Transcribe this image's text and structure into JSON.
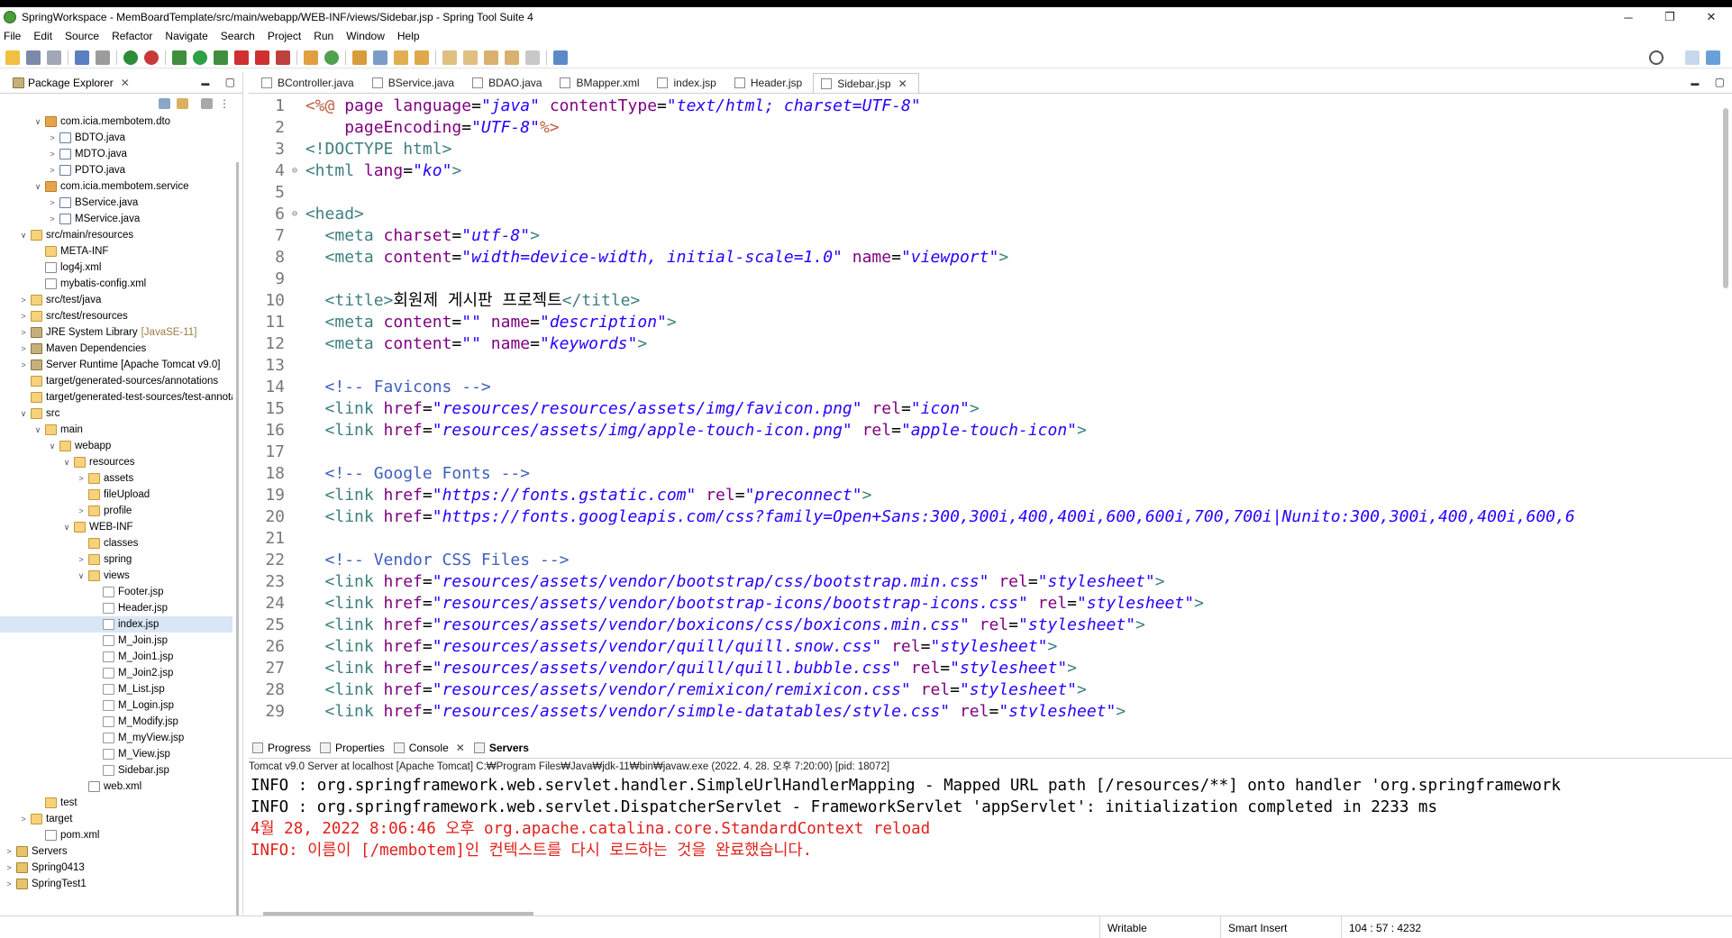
{
  "window": {
    "title": "SpringWorkspace - MemBoardTemplate/src/main/webapp/WEB-INF/views/Sidebar.jsp - Spring Tool Suite 4",
    "controls": [
      "─",
      "❐",
      "✕"
    ]
  },
  "menu": [
    {
      "label": "File"
    },
    {
      "label": "Edit"
    },
    {
      "label": "Source"
    },
    {
      "label": "Refactor"
    },
    {
      "label": "Navigate"
    },
    {
      "label": "Search"
    },
    {
      "label": "Project"
    },
    {
      "label": "Run"
    },
    {
      "label": "Window"
    },
    {
      "label": "Help"
    }
  ],
  "package_explorer": {
    "tab_label": "Package Explorer",
    "close": "✕",
    "minimize": "▬",
    "maximize": "▢",
    "tree": [
      {
        "indent": 2,
        "twisty": "∨",
        "icon": "pkg",
        "label": "com.icia.membotem.dto"
      },
      {
        "indent": 3,
        "twisty": ">",
        "icon": "java",
        "label": "BDTO.java"
      },
      {
        "indent": 3,
        "twisty": ">",
        "icon": "java",
        "label": "MDTO.java"
      },
      {
        "indent": 3,
        "twisty": ">",
        "icon": "java",
        "label": "PDTO.java"
      },
      {
        "indent": 2,
        "twisty": "∨",
        "icon": "pkg",
        "label": "com.icia.membotem.service"
      },
      {
        "indent": 3,
        "twisty": ">",
        "icon": "java",
        "label": "BService.java"
      },
      {
        "indent": 3,
        "twisty": ">",
        "icon": "java",
        "label": "MService.java"
      },
      {
        "indent": 1,
        "twisty": "∨",
        "icon": "srcf",
        "label": "src/main/resources"
      },
      {
        "indent": 2,
        "twisty": "",
        "icon": "folder",
        "label": "META-INF"
      },
      {
        "indent": 2,
        "twisty": "",
        "icon": "xml",
        "label": "log4j.xml"
      },
      {
        "indent": 2,
        "twisty": "",
        "icon": "xml",
        "label": "mybatis-config.xml"
      },
      {
        "indent": 1,
        "twisty": ">",
        "icon": "srcf",
        "label": "src/test/java"
      },
      {
        "indent": 1,
        "twisty": ">",
        "icon": "srcf",
        "label": "src/test/resources"
      },
      {
        "indent": 1,
        "twisty": ">",
        "icon": "lib",
        "label": "JRE System Library",
        "deco": "[JavaSE-11]"
      },
      {
        "indent": 1,
        "twisty": ">",
        "icon": "lib",
        "label": "Maven Dependencies"
      },
      {
        "indent": 1,
        "twisty": ">",
        "icon": "lib",
        "label": "Server Runtime [Apache Tomcat v9.0]"
      },
      {
        "indent": 1,
        "twisty": "",
        "icon": "folder",
        "label": "target/generated-sources/annotations"
      },
      {
        "indent": 1,
        "twisty": "",
        "icon": "folder",
        "label": "target/generated-test-sources/test-annotations"
      },
      {
        "indent": 1,
        "twisty": "∨",
        "icon": "folder",
        "label": "src"
      },
      {
        "indent": 2,
        "twisty": "∨",
        "icon": "folder",
        "label": "main"
      },
      {
        "indent": 3,
        "twisty": "∨",
        "icon": "folder",
        "label": "webapp"
      },
      {
        "indent": 4,
        "twisty": "∨",
        "icon": "folder",
        "label": "resources"
      },
      {
        "indent": 5,
        "twisty": ">",
        "icon": "folder",
        "label": "assets"
      },
      {
        "indent": 5,
        "twisty": "",
        "icon": "folder",
        "label": "fileUpload"
      },
      {
        "indent": 5,
        "twisty": ">",
        "icon": "folder",
        "label": "profile"
      },
      {
        "indent": 4,
        "twisty": "∨",
        "icon": "folder",
        "label": "WEB-INF"
      },
      {
        "indent": 5,
        "twisty": "",
        "icon": "folder",
        "label": "classes"
      },
      {
        "indent": 5,
        "twisty": ">",
        "icon": "folder",
        "label": "spring"
      },
      {
        "indent": 5,
        "twisty": "∨",
        "icon": "folder",
        "label": "views"
      },
      {
        "indent": 6,
        "twisty": "",
        "icon": "jsp",
        "label": "Footer.jsp"
      },
      {
        "indent": 6,
        "twisty": "",
        "icon": "jsp",
        "label": "Header.jsp"
      },
      {
        "indent": 6,
        "twisty": "",
        "icon": "jsp",
        "label": "index.jsp",
        "selected": true
      },
      {
        "indent": 6,
        "twisty": "",
        "icon": "jsp",
        "label": "M_Join.jsp"
      },
      {
        "indent": 6,
        "twisty": "",
        "icon": "jsp",
        "label": "M_Join1.jsp"
      },
      {
        "indent": 6,
        "twisty": "",
        "icon": "jsp",
        "label": "M_Join2.jsp"
      },
      {
        "indent": 6,
        "twisty": "",
        "icon": "jsp",
        "label": "M_List.jsp"
      },
      {
        "indent": 6,
        "twisty": "",
        "icon": "jsp",
        "label": "M_Login.jsp"
      },
      {
        "indent": 6,
        "twisty": "",
        "icon": "jsp",
        "label": "M_Modify.jsp"
      },
      {
        "indent": 6,
        "twisty": "",
        "icon": "jsp",
        "label": "M_myView.jsp"
      },
      {
        "indent": 6,
        "twisty": "",
        "icon": "jsp",
        "label": "M_View.jsp"
      },
      {
        "indent": 6,
        "twisty": "",
        "icon": "jsp",
        "label": "Sidebar.jsp"
      },
      {
        "indent": 5,
        "twisty": "",
        "icon": "xml",
        "label": "web.xml"
      },
      {
        "indent": 2,
        "twisty": "",
        "icon": "folder",
        "label": "test"
      },
      {
        "indent": 1,
        "twisty": ">",
        "icon": "folder",
        "label": "target"
      },
      {
        "indent": 2,
        "twisty": "",
        "icon": "xml",
        "label": "pom.xml"
      },
      {
        "indent": 0,
        "twisty": ">",
        "icon": "proj",
        "label": "Servers"
      },
      {
        "indent": 0,
        "twisty": ">",
        "icon": "proj",
        "label": "Spring0413"
      },
      {
        "indent": 0,
        "twisty": ">",
        "icon": "proj",
        "label": "SpringTest1"
      }
    ]
  },
  "editor": {
    "tabs": [
      {
        "label": "BController.java",
        "active": false
      },
      {
        "label": "BService.java",
        "active": false
      },
      {
        "label": "BDAO.java",
        "active": false
      },
      {
        "label": "BMapper.xml",
        "active": false
      },
      {
        "label": "index.jsp",
        "active": false
      },
      {
        "label": "Header.jsp",
        "active": false
      },
      {
        "label": "Sidebar.jsp",
        "active": true
      }
    ],
    "close": "✕",
    "lines": [
      {
        "n": "1",
        "fold": "",
        "html": "<span class='dir'>&lt;%@</span> <span class='an'>page</span> <span class='an'>language</span>=<span class='av'>\"java\"</span> <span class='an'>contentType</span>=<span class='av'>\"text/html; charset=UTF-8\"</span>"
      },
      {
        "n": "2",
        "fold": "",
        "html": "    <span class='an'>pageEncoding</span>=<span class='av'>\"UTF-8\"</span><span class='dir'>%&gt;</span>"
      },
      {
        "n": "3",
        "fold": "",
        "html": "<span class='tag'>&lt;!DOCTYPE html&gt;</span>"
      },
      {
        "n": "4",
        "fold": "⊖",
        "html": "<span class='tag'>&lt;html</span> <span class='an'>lang</span>=<span class='av'>\"ko\"</span><span class='tag'>&gt;</span>"
      },
      {
        "n": "5",
        "fold": "",
        "html": ""
      },
      {
        "n": "6",
        "fold": "⊖",
        "html": "<span class='tag'>&lt;head&gt;</span>"
      },
      {
        "n": "7",
        "fold": "",
        "html": "  <span class='tag'>&lt;meta</span> <span class='an'>charset</span>=<span class='av'>\"utf-8\"</span><span class='tag'>&gt;</span>"
      },
      {
        "n": "8",
        "fold": "",
        "html": "  <span class='tag'>&lt;meta</span> <span class='an'>content</span>=<span class='av'>\"width=device-width, initial-scale=1.0\"</span> <span class='an'>name</span>=<span class='av'>\"viewport\"</span><span class='tag'>&gt;</span>"
      },
      {
        "n": "9",
        "fold": "",
        "html": ""
      },
      {
        "n": "10",
        "fold": "",
        "html": "  <span class='tag'>&lt;title&gt;</span>회원제 게시판 프로젝트<span class='tag'>&lt;/title&gt;</span>"
      },
      {
        "n": "11",
        "fold": "",
        "html": "  <span class='tag'>&lt;meta</span> <span class='an'>content</span>=<span class='av'>\"\"</span> <span class='an'>name</span>=<span class='av'>\"description\"</span><span class='tag'>&gt;</span>"
      },
      {
        "n": "12",
        "fold": "",
        "html": "  <span class='tag'>&lt;meta</span> <span class='an'>content</span>=<span class='av'>\"\"</span> <span class='an'>name</span>=<span class='av'>\"keywords\"</span><span class='tag'>&gt;</span>"
      },
      {
        "n": "13",
        "fold": "",
        "html": ""
      },
      {
        "n": "14",
        "fold": "",
        "html": "  <span class='cm'>&lt;!-- Favicons --&gt;</span>"
      },
      {
        "n": "15",
        "fold": "",
        "html": "  <span class='tag'>&lt;link</span> <span class='an'>href</span>=<span class='av'>\"resources/resources/assets/img/favicon.png\"</span> <span class='an'>rel</span>=<span class='av'>\"icon\"</span><span class='tag'>&gt;</span>"
      },
      {
        "n": "16",
        "fold": "",
        "html": "  <span class='tag'>&lt;link</span> <span class='an'>href</span>=<span class='av'>\"resources/assets/img/apple-touch-icon.png\"</span> <span class='an'>rel</span>=<span class='av'>\"apple-touch-icon\"</span><span class='tag'>&gt;</span>"
      },
      {
        "n": "17",
        "fold": "",
        "html": ""
      },
      {
        "n": "18",
        "fold": "",
        "html": "  <span class='cm'>&lt;!-- Google Fonts --&gt;</span>"
      },
      {
        "n": "19",
        "fold": "",
        "html": "  <span class='tag'>&lt;link</span> <span class='an'>href</span>=<span class='av'>\"https://fonts.gstatic.com\"</span> <span class='an'>rel</span>=<span class='av'>\"preconnect\"</span><span class='tag'>&gt;</span>"
      },
      {
        "n": "20",
        "fold": "",
        "html": "  <span class='tag'>&lt;link</span> <span class='an'>href</span>=<span class='av'>\"https://fonts.googleapis.com/css?family=Open+Sans:300,300i,400,400i,600,600i,700,700i|Nunito:300,300i,400,400i,600,6</span>"
      },
      {
        "n": "21",
        "fold": "",
        "html": ""
      },
      {
        "n": "22",
        "fold": "",
        "html": "  <span class='cm'>&lt;!-- Vendor CSS Files --&gt;</span>"
      },
      {
        "n": "23",
        "fold": "",
        "html": "  <span class='tag'>&lt;link</span> <span class='an'>href</span>=<span class='av'>\"resources/assets/vendor/bootstrap/css/bootstrap.min.css\"</span> <span class='an'>rel</span>=<span class='av'>\"stylesheet\"</span><span class='tag'>&gt;</span>"
      },
      {
        "n": "24",
        "fold": "",
        "html": "  <span class='tag'>&lt;link</span> <span class='an'>href</span>=<span class='av'>\"resources/assets/vendor/bootstrap-icons/bootstrap-icons.css\"</span> <span class='an'>rel</span>=<span class='av'>\"stylesheet\"</span><span class='tag'>&gt;</span>"
      },
      {
        "n": "25",
        "fold": "",
        "html": "  <span class='tag'>&lt;link</span> <span class='an'>href</span>=<span class='av'>\"resources/assets/vendor/boxicons/css/boxicons.min.css\"</span> <span class='an'>rel</span>=<span class='av'>\"stylesheet\"</span><span class='tag'>&gt;</span>"
      },
      {
        "n": "26",
        "fold": "",
        "html": "  <span class='tag'>&lt;link</span> <span class='an'>href</span>=<span class='av'>\"resources/assets/vendor/quill/quill.snow.css\"</span> <span class='an'>rel</span>=<span class='av'>\"stylesheet\"</span><span class='tag'>&gt;</span>"
      },
      {
        "n": "27",
        "fold": "",
        "html": "  <span class='tag'>&lt;link</span> <span class='an'>href</span>=<span class='av'>\"resources/assets/vendor/quill/quill.bubble.css\"</span> <span class='an'>rel</span>=<span class='av'>\"stylesheet\"</span><span class='tag'>&gt;</span>"
      },
      {
        "n": "28",
        "fold": "",
        "html": "  <span class='tag'>&lt;link</span> <span class='an'>href</span>=<span class='av'>\"resources/assets/vendor/remixicon/remixicon.css\"</span> <span class='an'>rel</span>=<span class='av'>\"stylesheet\"</span><span class='tag'>&gt;</span>"
      },
      {
        "n": "29",
        "fold": "",
        "html": "  <span class='tag'>&lt;link</span> <span class='an'>href</span>=<span class='av'>\"resources/assets/vendor/simple-datatables/style.css\"</span> <span class='an'>rel</span>=<span class='av'>\"stylesheet\"</span><span class='tag'>&gt;</span>"
      }
    ]
  },
  "console": {
    "tabs": [
      {
        "label": "Progress",
        "active": false,
        "close": false
      },
      {
        "label": "Properties",
        "active": false,
        "close": false
      },
      {
        "label": "Console",
        "active": true,
        "close": true
      },
      {
        "label": "Servers",
        "active": false,
        "close": false
      }
    ],
    "close": "✕",
    "description": "Tomcat v9.0 Server at localhost [Apache Tomcat] C:₩Program Files₩Java₩jdk-11₩bin₩javaw.exe  (2022. 4. 28. 오후 7:20:00) [pid: 18072]",
    "lines": [
      {
        "kind": "info",
        "text": "INFO : org.springframework.web.servlet.handler.SimpleUrlHandlerMapping - Mapped URL path [/resources/**] onto handler 'org.springframework"
      },
      {
        "kind": "info",
        "text": "INFO : org.springframework.web.servlet.DispatcherServlet - FrameworkServlet 'appServlet': initialization completed in 2233 ms"
      },
      {
        "kind": "err",
        "text": "4월 28, 2022 8:06:46 오후 org.apache.catalina.core.StandardContext reload"
      },
      {
        "kind": "err",
        "text": "INFO: 이름이 [/membotem]인 컨텍스트를 다시 로드하는 것을 완료했습니다."
      }
    ]
  },
  "status_bar": {
    "writable": "Writable",
    "insert_mode": "Smart Insert",
    "position": "104 : 57 : 4232"
  }
}
